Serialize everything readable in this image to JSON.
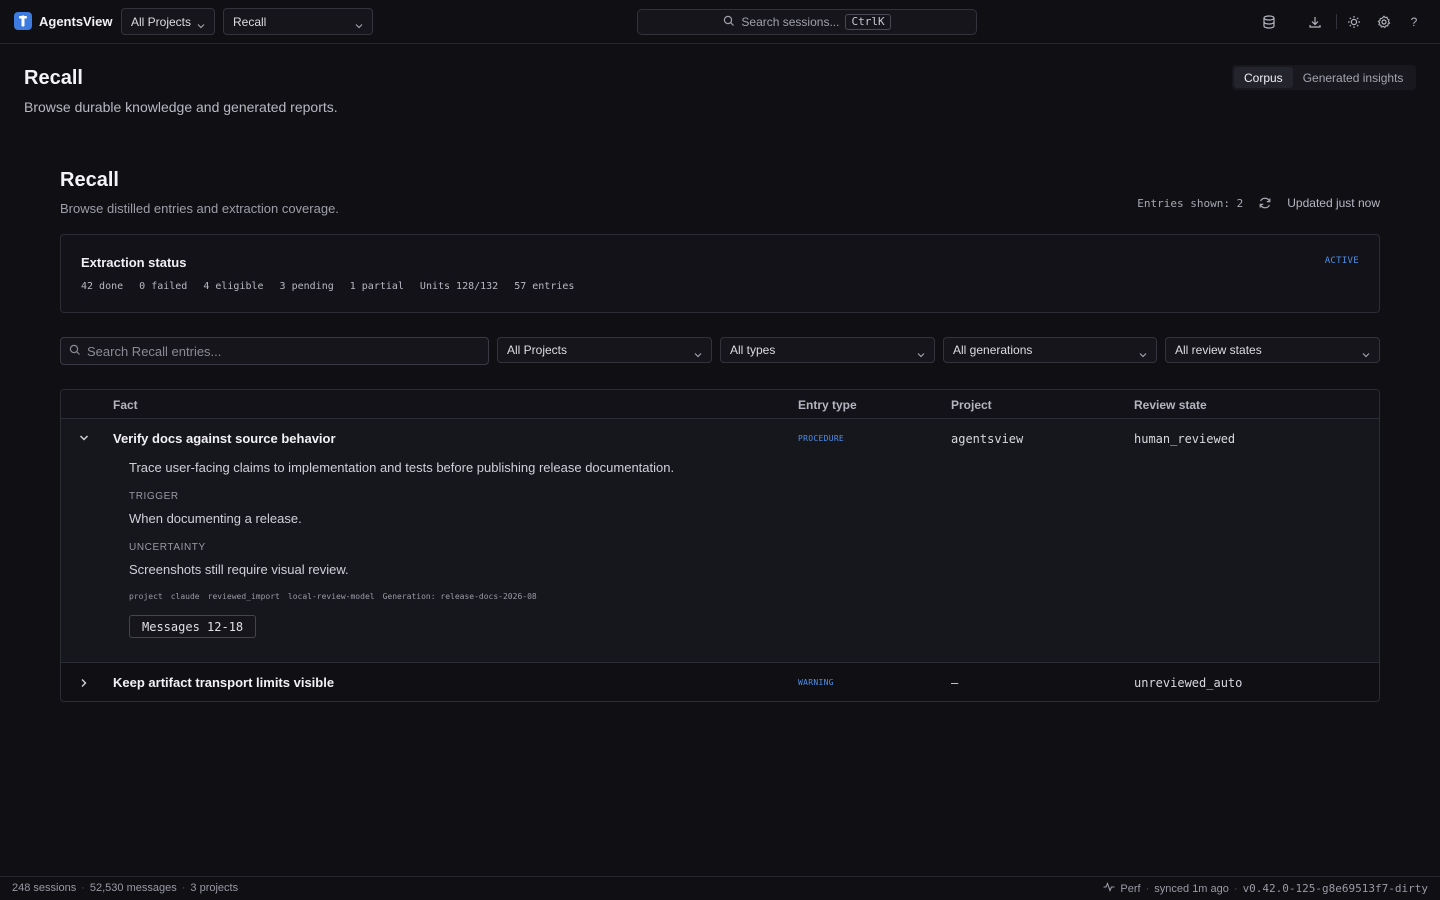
{
  "app": {
    "name": "AgentsView",
    "project_select": "All Projects",
    "view_select": "Recall",
    "search_placeholder": "Search sessions...",
    "search_shortcut": "CtrlK"
  },
  "page": {
    "title": "Recall",
    "subtitle": "Browse durable knowledge and generated reports.",
    "tabs": [
      "Corpus",
      "Generated insights"
    ],
    "active_tab": "Corpus"
  },
  "recall": {
    "title": "Recall",
    "subtitle": "Browse distilled entries and extraction coverage.",
    "entries_shown": "Entries shown: 2",
    "updated": "Updated just now"
  },
  "extraction": {
    "title": "Extraction status",
    "badge": "ACTIVE",
    "stats": [
      "42 done",
      "0 failed",
      "4 eligible",
      "3 pending",
      "1 partial",
      "Units 128/132",
      "57 entries"
    ]
  },
  "filters": {
    "search_placeholder": "Search Recall entries...",
    "project": "All Projects",
    "type": "All types",
    "generation": "All generations",
    "review": "All review states"
  },
  "table": {
    "headers": {
      "fact": "Fact",
      "type": "Entry type",
      "project": "Project",
      "review": "Review state"
    },
    "rows": [
      {
        "fact": "Verify docs against source behavior",
        "type": "PROCEDURE",
        "project": "agentsview",
        "review": "human_reviewed",
        "description": "Trace user-facing claims to implementation and tests before publishing release documentation.",
        "trigger_label": "TRIGGER",
        "trigger": "When documenting a release.",
        "uncertainty_label": "UNCERTAINTY",
        "uncertainty": "Screenshots still require visual review.",
        "tags": [
          "project",
          "claude",
          "reviewed_import",
          "local-review-model",
          "Generation: release-docs-2026-08"
        ],
        "messages": "Messages 12-18"
      },
      {
        "fact": "Keep artifact transport limits visible",
        "type": "WARNING",
        "project": "—",
        "review": "unreviewed_auto"
      }
    ]
  },
  "footer": {
    "sessions": "248 sessions",
    "messages": "52,530 messages",
    "projects": "3 projects",
    "perf": "Perf",
    "synced": "synced 1m ago",
    "version": "v0.42.0-125-g8e69513f7-dirty"
  },
  "colors": {
    "accent": "#4f8fe8",
    "background": "#0f0f14"
  }
}
